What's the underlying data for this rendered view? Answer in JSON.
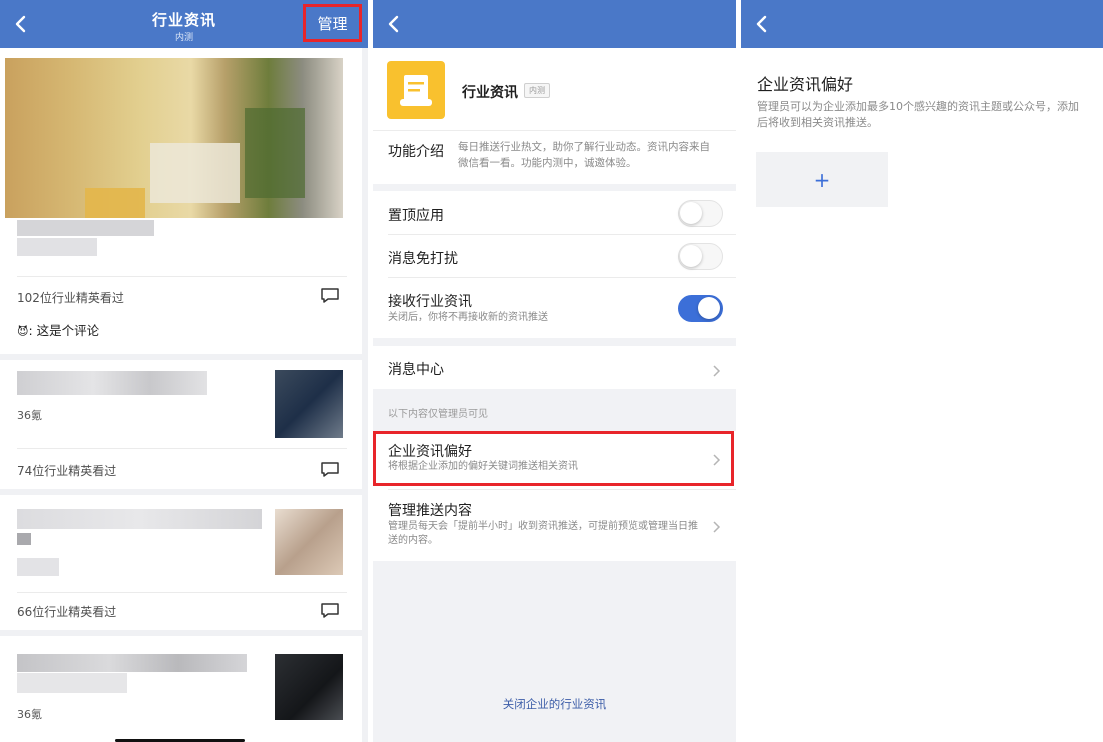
{
  "feed": {
    "title": "行业资讯",
    "subtitle": "内测",
    "manage_label": "管理",
    "cards": [
      {
        "views": "102位行业精英看过",
        "comment_emoji": "😈",
        "comment_text": ": 这是个评论"
      },
      {
        "count": "36氪",
        "views": "74位行业精英看过"
      },
      {
        "views": "66位行业精英看过"
      },
      {
        "count": "36氪"
      }
    ]
  },
  "settings": {
    "app_name": "行业资讯",
    "app_tag": "内测",
    "intro_label": "功能介绍",
    "intro_text": "每日推送行业热文，助你了解行业动态。资讯内容来自微信看一看。功能内测中，诚邀体验。",
    "rows": {
      "pin": {
        "label": "置顶应用",
        "on": false
      },
      "mute": {
        "label": "消息免打扰",
        "on": false
      },
      "receive": {
        "label": "接收行业资讯",
        "sub": "关闭后，你将不再接收新的资讯推送",
        "on": true
      },
      "msg_center": {
        "label": "消息中心"
      }
    },
    "admin_note": "以下内容仅管理员可见",
    "pref": {
      "label": "企业资讯偏好",
      "sub": "将根据企业添加的偏好关键词推送相关资讯"
    },
    "push": {
      "label": "管理推送内容",
      "sub": "管理员每天会「提前半小时」收到资讯推送，可提前预览或管理当日推送的内容。"
    },
    "close_link": "关闭企业的行业资讯"
  },
  "preference": {
    "title": "企业资讯偏好",
    "desc": "管理员可以为企业添加最多10个感兴趣的资讯主题或公众号，添加后将收到相关资讯推送。",
    "add_label": "+"
  },
  "colors": {
    "accent": "#4a78c8",
    "highlight": "#e8252a",
    "toggle_on": "#3c6fd8"
  }
}
